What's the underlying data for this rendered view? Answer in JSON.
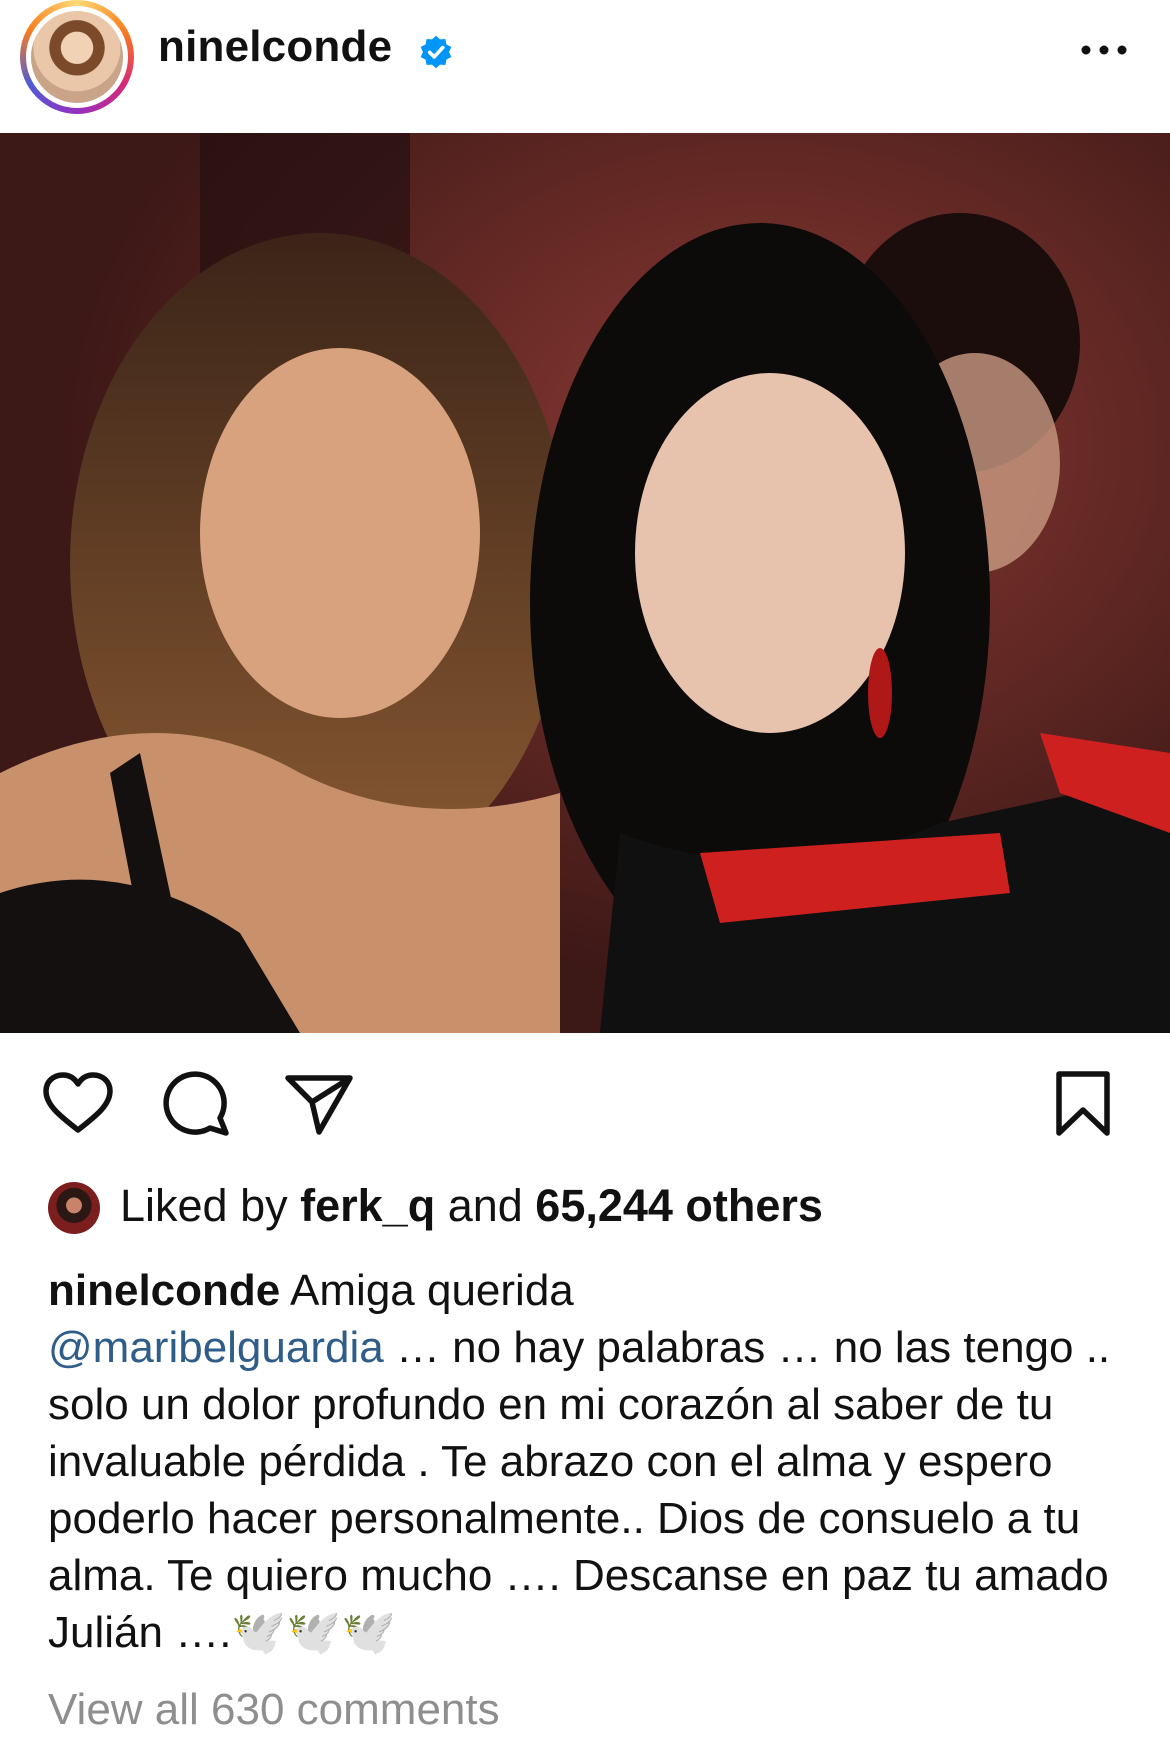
{
  "header": {
    "username": "ninelconde",
    "verified": true,
    "more_icon": "more-horizontal-icon"
  },
  "post": {
    "photo_alt": "Two women posing together",
    "user_tag_icon": "person-icon"
  },
  "actions": {
    "like_icon": "heart-icon",
    "comment_icon": "comment-bubble-icon",
    "share_icon": "paper-plane-icon",
    "save_icon": "bookmark-icon"
  },
  "likes": {
    "prefix": "Liked by ",
    "user": "ferk_q",
    "middle": " and ",
    "count": "65,244 others"
  },
  "caption": {
    "username": "ninelconde",
    "first_line": " Amiga querida",
    "mention": "@maribelguardia",
    "body": " … no hay palabras … no las tengo .. solo un dolor profundo en mi corazón  al saber de tu invaluable pérdida . Te abrazo con el alma y espero poderlo hacer personalmente.. Dios de consuelo a tu alma. Te quiero mucho …. Descanse en paz tu amado Julián ….🕊️🕊️🕊️"
  },
  "comments": {
    "view_all": "View all 630 comments"
  },
  "colors": {
    "verified_blue": "#0095f6",
    "mention": "#2f5d8a",
    "muted": "#8e8e8e"
  }
}
